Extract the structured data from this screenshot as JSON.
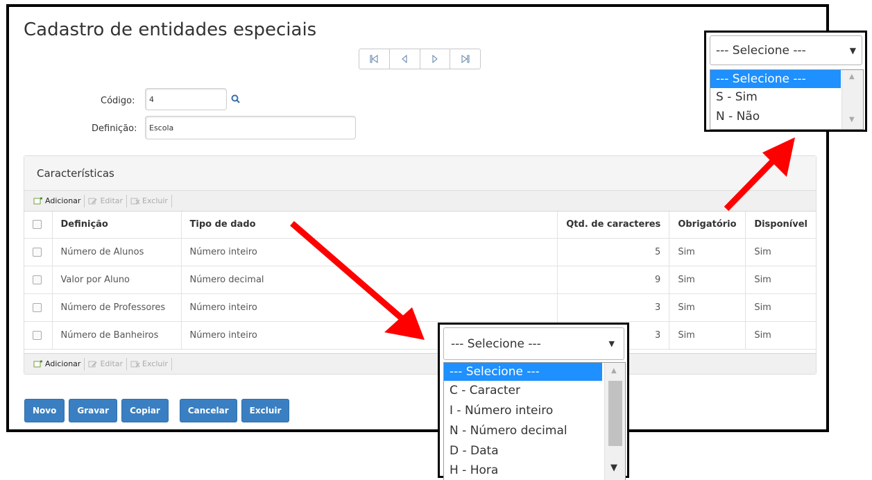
{
  "page": {
    "title": "Cadastro de entidades especiais"
  },
  "nav": {
    "first": "first-page-icon",
    "prev": "prev-page-icon",
    "next": "next-page-icon",
    "last": "last-page-icon"
  },
  "form": {
    "code_label": "Código:",
    "code_value": "4",
    "definition_label": "Definição:",
    "definition_value": "Escola"
  },
  "panel": {
    "title": "Características",
    "toolbar": {
      "add": "Adicionar",
      "edit": "Editar",
      "delete": "Excluir"
    },
    "columns": [
      "Definição",
      "Tipo de dado",
      "Qtd. de caracteres",
      "Obrigatório",
      "Disponível"
    ],
    "rows": [
      {
        "definicao": "Número de Alunos",
        "tipo": "Número inteiro",
        "qtd": "5",
        "obrigatorio": "Sim",
        "disponivel": "Sim"
      },
      {
        "definicao": "Valor por Aluno",
        "tipo": "Número decimal",
        "qtd": "9",
        "obrigatorio": "Sim",
        "disponivel": "Sim"
      },
      {
        "definicao": "Número de Professores",
        "tipo": "Número inteiro",
        "qtd": "3",
        "obrigatorio": "Sim",
        "disponivel": "Sim"
      },
      {
        "definicao": "Número de Banheiros",
        "tipo": "Número inteiro",
        "qtd": "3",
        "obrigatorio": "Sim",
        "disponivel": "Sim"
      }
    ]
  },
  "actions": {
    "novo": "Novo",
    "gravar": "Gravar",
    "copiar": "Copiar",
    "cancelar": "Cancelar",
    "excluir": "Excluir"
  },
  "obrigatorio_dropdown": {
    "selected": "--- Selecione ---",
    "options": [
      "--- Selecione ---",
      "S - Sim",
      "N - Não"
    ]
  },
  "tipo_dropdown": {
    "selected": "--- Selecione ---",
    "options": [
      "--- Selecione ---",
      "C - Caracter",
      "I - Número inteiro",
      "N - Número decimal",
      "D - Data",
      "H - Hora"
    ]
  },
  "colors": {
    "primary_button": "#3a7fc1",
    "selected_option": "#1e90ff",
    "arrow": "#ff0000"
  }
}
